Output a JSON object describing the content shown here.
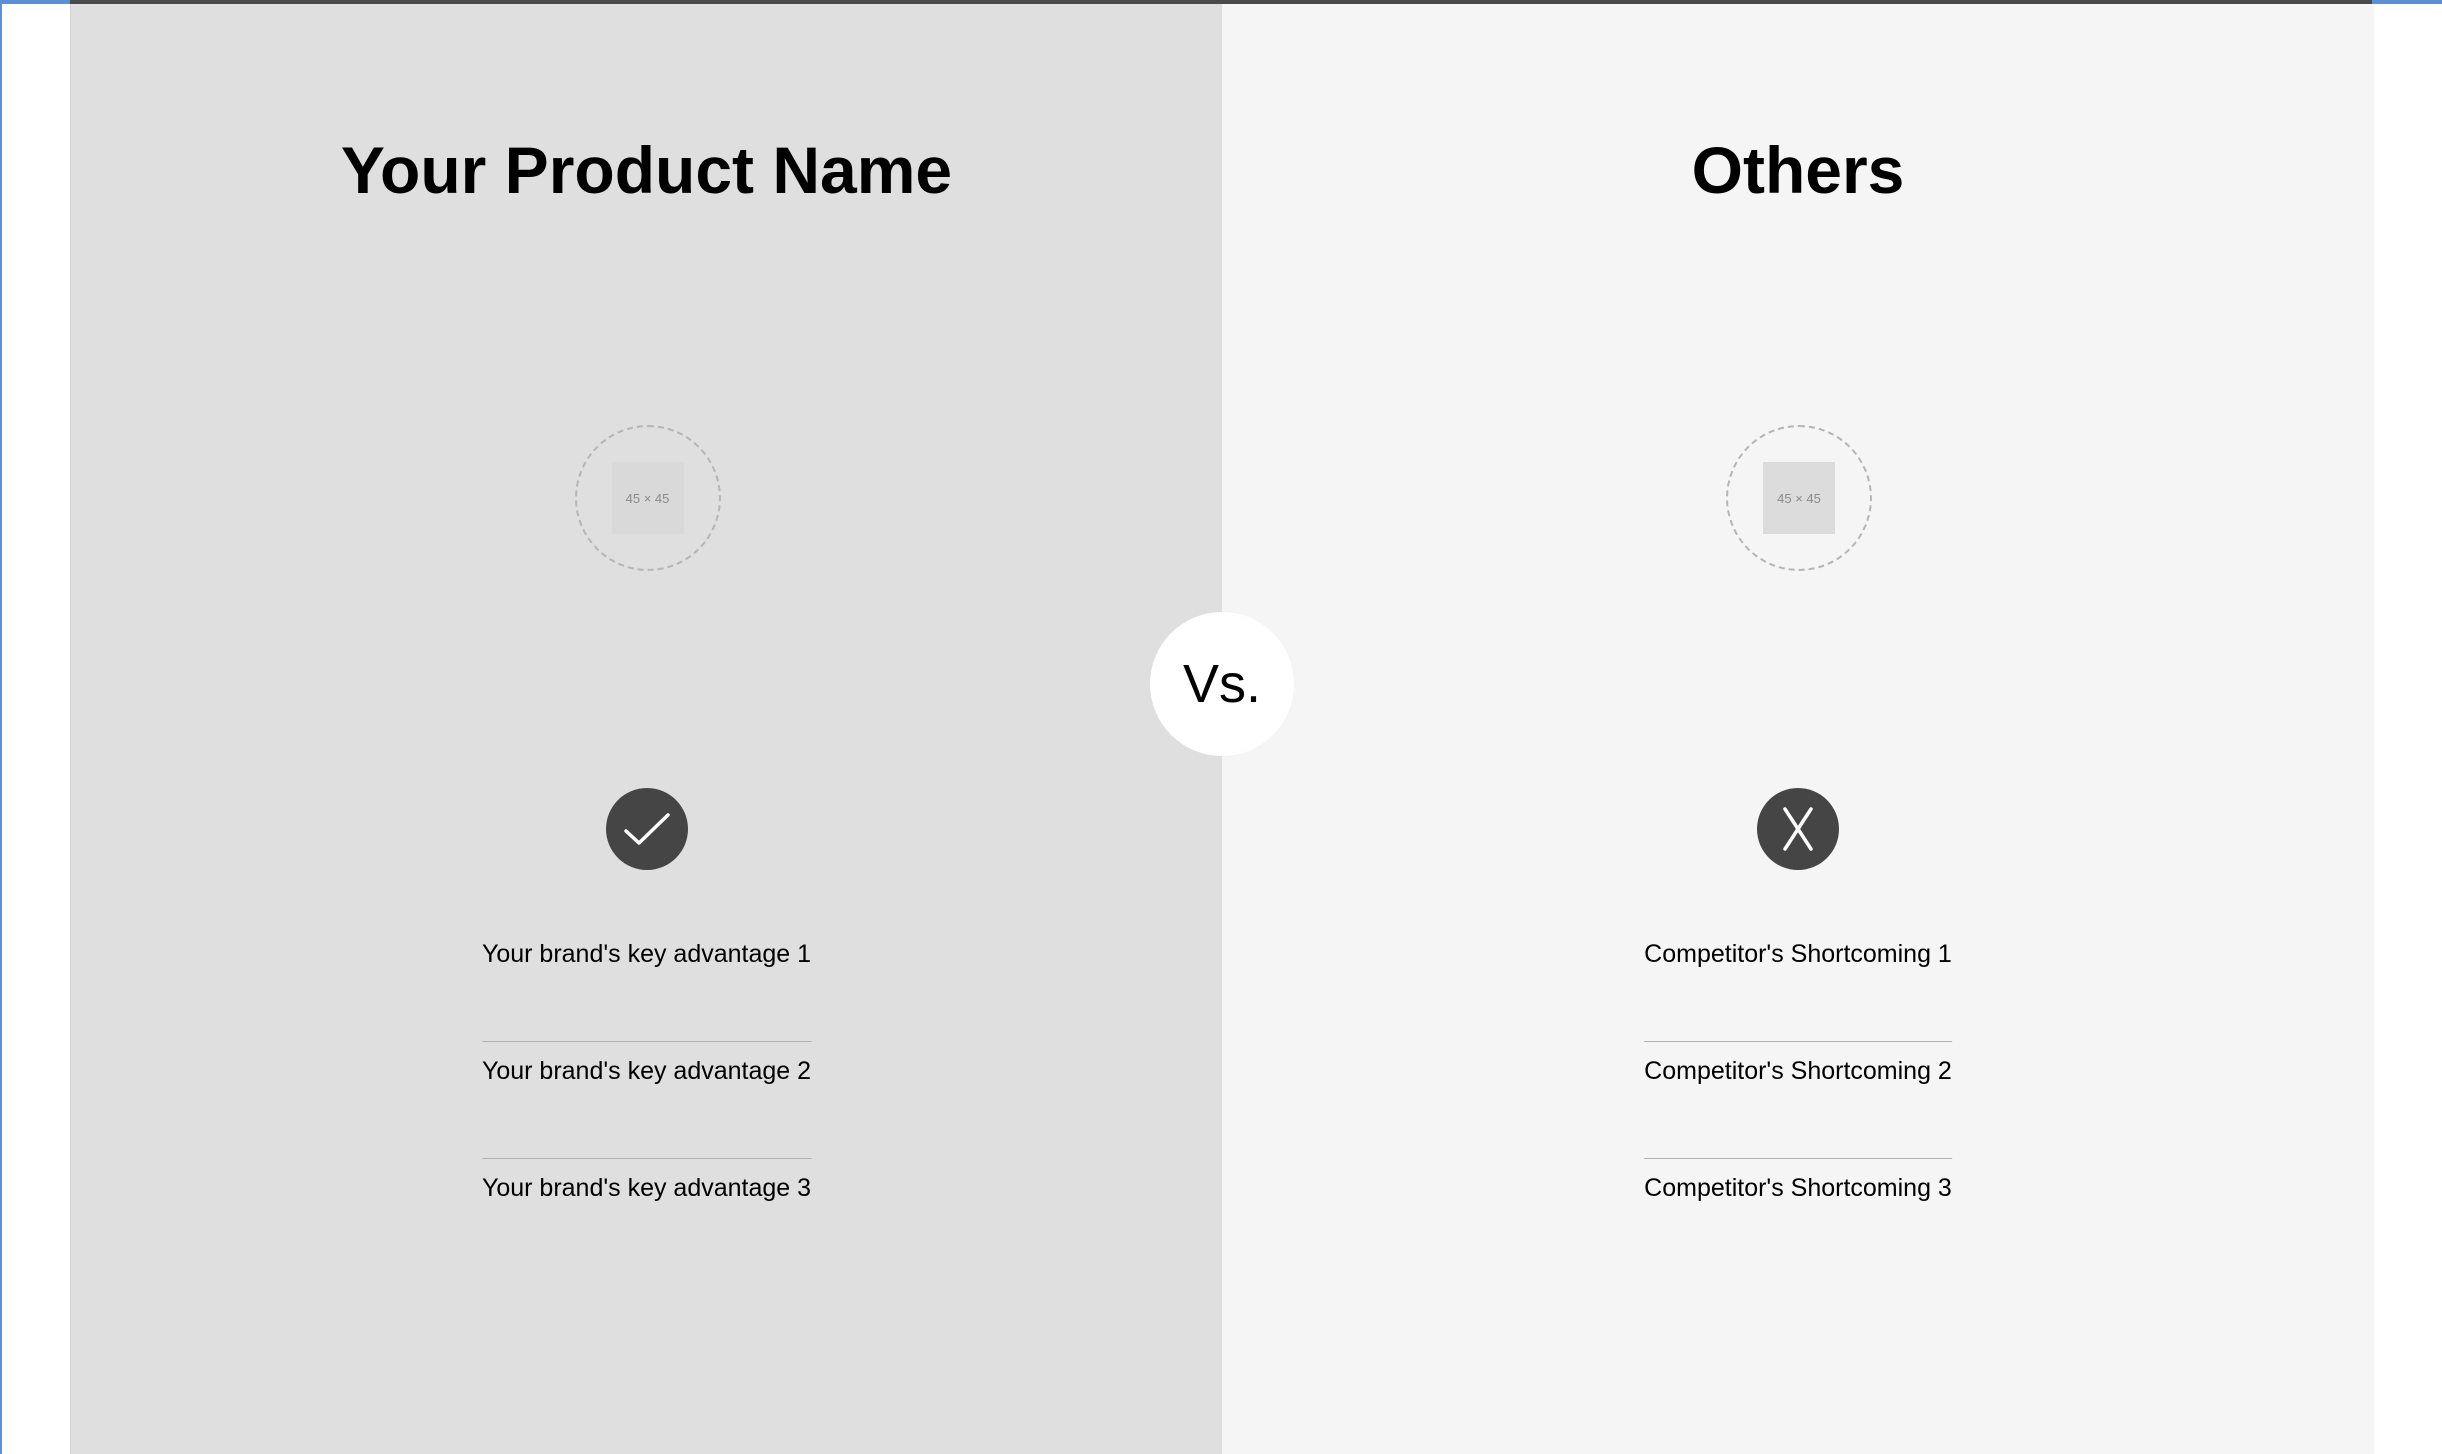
{
  "left_column": {
    "title": "Your Product Name",
    "logo_placeholder": "45 × 45",
    "status_icon": "checkmark-icon",
    "points": [
      "Your brand's key advantage 1",
      "Your brand's key advantage 2",
      "Your brand's key advantage 3"
    ],
    "background": "#dfdfdf"
  },
  "right_column": {
    "title": "Others",
    "logo_placeholder": "45 × 45",
    "status_icon": "x-mark-icon",
    "points": [
      "Competitor's Shortcoming 1",
      "Competitor's Shortcoming 2",
      "Competitor's Shortcoming 3"
    ],
    "background": "#f5f5f5"
  },
  "vs_badge": {
    "label": "Vs."
  },
  "colors": {
    "icon_circle": "#454545",
    "divider": "#b0b0b0",
    "accent_frame": "#5b8fd6"
  }
}
